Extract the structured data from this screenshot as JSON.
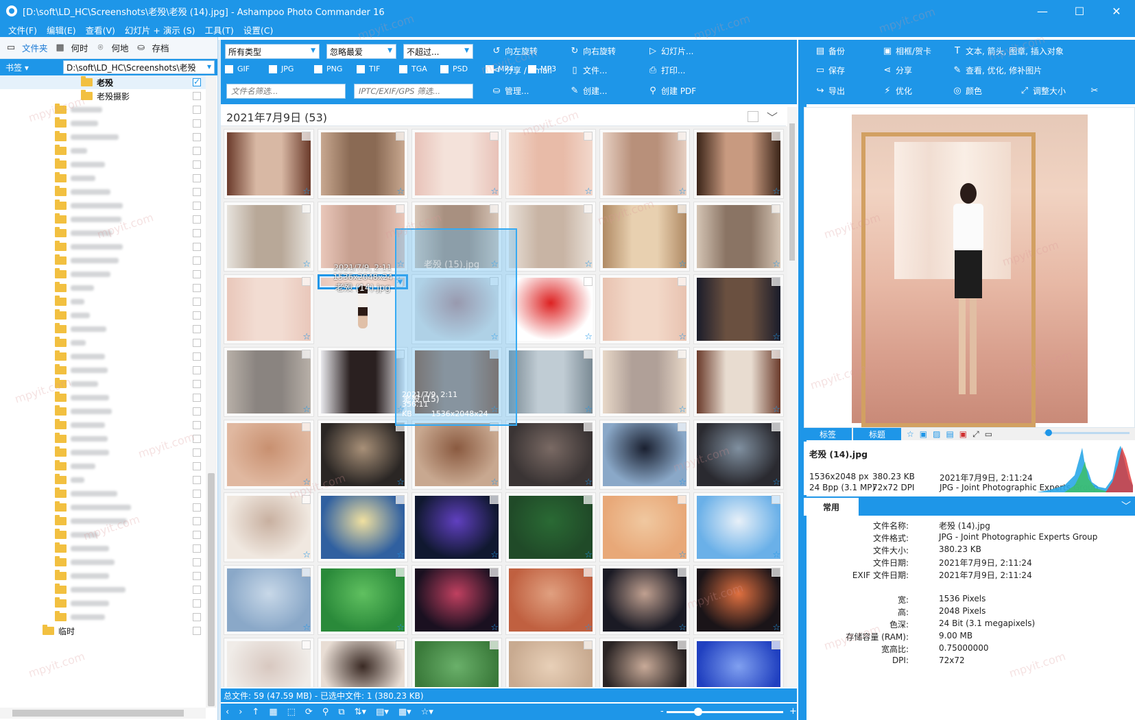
{
  "window": {
    "title": "[D:\\soft\\LD_HC\\Screenshots\\老殁\\老殁 (14).jpg] - Ashampoo Photo Commander 16"
  },
  "menu": [
    "文件(F)",
    "编辑(E)",
    "查看(V)",
    "幻灯片 + 演示 (S)",
    "工具(T)",
    "设置(C)"
  ],
  "left": {
    "tabs": [
      "文件夹",
      "何时",
      "何地",
      "存档"
    ],
    "bookmark_label": "书签",
    "path": "D:\\soft\\LD_HC\\Screenshots\\老殁",
    "tree": [
      {
        "label": "老殁",
        "checked": true,
        "bold": true
      },
      {
        "label": "老殁摄影",
        "checked": false
      },
      {
        "label": "",
        "checked": false
      },
      {
        "label": "",
        "checked": false
      },
      {
        "label": "",
        "checked": false
      },
      {
        "label": "",
        "checked": false
      },
      {
        "label": "",
        "checked": false
      },
      {
        "label": "",
        "checked": false
      },
      {
        "label": "",
        "checked": false
      },
      {
        "label": "",
        "checked": false
      },
      {
        "label": "",
        "checked": false
      },
      {
        "label": "",
        "checked": false
      },
      {
        "label": "",
        "checked": false
      },
      {
        "label": "",
        "checked": false
      },
      {
        "label": "",
        "checked": false
      },
      {
        "label": "",
        "checked": false
      },
      {
        "label": "",
        "checked": false
      },
      {
        "label": "",
        "checked": false
      },
      {
        "label": "",
        "checked": false
      },
      {
        "label": "",
        "checked": false
      },
      {
        "label": "",
        "checked": false
      },
      {
        "label": "",
        "checked": false
      },
      {
        "label": "",
        "checked": false
      },
      {
        "label": "",
        "checked": false
      },
      {
        "label": "",
        "checked": false
      },
      {
        "label": "",
        "checked": false
      },
      {
        "label": "",
        "checked": false
      },
      {
        "label": "",
        "checked": false
      },
      {
        "label": "",
        "checked": false
      },
      {
        "label": "",
        "checked": false
      },
      {
        "label": "",
        "checked": false
      },
      {
        "label": "",
        "checked": false
      },
      {
        "label": "",
        "checked": false
      },
      {
        "label": "",
        "checked": false
      },
      {
        "label": "",
        "checked": false
      },
      {
        "label": "",
        "checked": false
      },
      {
        "label": "",
        "checked": false
      },
      {
        "label": "",
        "checked": false
      },
      {
        "label": "",
        "checked": false
      },
      {
        "label": "",
        "checked": false
      },
      {
        "label": "临时",
        "checked": false
      }
    ]
  },
  "toolbar": {
    "type_select": "所有类型",
    "fav_select": "忽略最爱",
    "limit_select": "不超过...",
    "types": [
      "GIF",
      "JPG",
      "PNG",
      "TIF",
      "TGA",
      "PSD",
      "MP4",
      "MP3"
    ],
    "name_filter_placeholder": "文件名筛选...",
    "iptc_filter_placeholder": "IPTC/EXIF/GPS 筛选...",
    "rotate_left": "向左旋转",
    "rotate_right": "向右旋转",
    "slideshow": "幻灯片...",
    "share_email": "分享 / Email",
    "file": "文件...",
    "print": "打印...",
    "manage": "管理...",
    "create": "创建...",
    "create_pdf": "创建 PDF"
  },
  "group": {
    "title": "2021年7月9日 (53)"
  },
  "selected_cell": {
    "filename": "老殁 (14).jpg",
    "date": "2021/7/9, 2:11",
    "dims": "1536x2048x24"
  },
  "drag": {
    "filename": "老殁 (15)",
    "date": "2021/7/9, 2:11",
    "size": "356.11 KB",
    "dims": "1536x2048x24",
    "ghost_name": "老殁 (15).jpg"
  },
  "status": {
    "text": "总文件: 59 (47.59 MB) - 已选中文件: 1 (380.23 KB)"
  },
  "right_toolbar": {
    "backup": "备份",
    "frames": "相框/贺卡",
    "text_objects": "文本, 箭头, 图章, 插入对象",
    "save": "保存",
    "share": "分享",
    "view_optimize": "查看, 优化, 修补图片",
    "export": "导出",
    "optimize": "优化",
    "color": "颜色",
    "resize": "调整大小"
  },
  "right_tabs": {
    "tags": "标签",
    "title": "标题"
  },
  "info": {
    "filename": "老殁 (14).jpg",
    "line1_a": "1536x2048 px",
    "line1_b": "380.23 KB",
    "line1_c": "2021年7月9日, 2:11:24",
    "line2_a": "24 Bpp (3.1 MP)",
    "line2_b": "72x72 DPI",
    "line2_c": "JPG - Joint Photographic Experts Group"
  },
  "section": {
    "label": "常用"
  },
  "props": [
    {
      "k": "文件名称:",
      "v": "老殁 (14).jpg"
    },
    {
      "k": "文件格式:",
      "v": "JPG - Joint Photographic Experts Group"
    },
    {
      "k": "文件大小:",
      "v": "380.23 KB"
    },
    {
      "k": "文件日期:",
      "v": "2021年7月9日, 2:11:24"
    },
    {
      "k": "EXIF 文件日期:",
      "v": "2021年7月9日, 2:11:24"
    },
    {
      "k": "",
      "v": ""
    },
    {
      "k": "宽:",
      "v": "1536 Pixels"
    },
    {
      "k": "高:",
      "v": "2048 Pixels"
    },
    {
      "k": "色深:",
      "v": "24 Bit (3.1 megapixels)"
    },
    {
      "k": "存储容量 (RAM):",
      "v": "9.00 MB"
    },
    {
      "k": "宽高比:",
      "v": "0.75000000"
    },
    {
      "k": "DPI:",
      "v": "72x72"
    }
  ],
  "watermark": "mpyit.com",
  "colors": {
    "accent": "#1e96e8",
    "folder": "#f2c040"
  }
}
